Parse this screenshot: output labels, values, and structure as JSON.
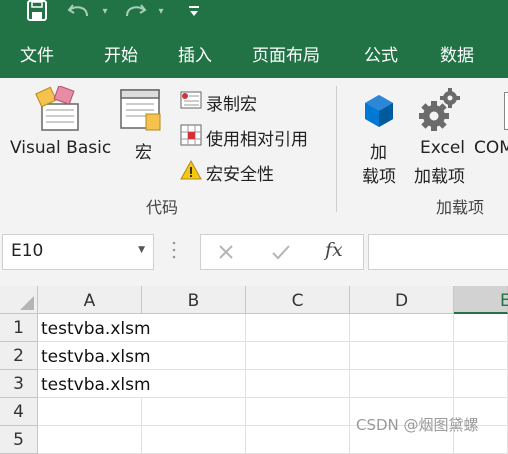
{
  "ribbon_tabs": [
    "文件",
    "开始",
    "插入",
    "页面布局",
    "公式",
    "数据"
  ],
  "code_group": {
    "visual_basic_label": "Visual Basic",
    "macros_label": "宏",
    "record_macro_label": "录制宏",
    "relative_refs_label": "使用相对引用",
    "macro_security_label": "宏安全性",
    "group_label": "代码"
  },
  "addins_group": {
    "addins_label_line1": "加",
    "addins_label_line2": "载项",
    "excel_addins_line1": "Excel",
    "excel_addins_line2": "加载项",
    "com_label": "COM",
    "group_label": "加载项"
  },
  "formula_bar": {
    "name_box": "E10",
    "fx_label": "fx",
    "formula_value": ""
  },
  "columns": [
    "A",
    "B",
    "C",
    "D",
    "E"
  ],
  "rows": [
    {
      "num": "1",
      "a": "testvba.xlsm"
    },
    {
      "num": "2",
      "a": "testvba.xlsm"
    },
    {
      "num": "3",
      "a": "testvba.xlsm"
    },
    {
      "num": "4",
      "a": ""
    },
    {
      "num": "5",
      "a": ""
    }
  ],
  "watermark": "CSDN @烟图黛螺",
  "colors": {
    "excel_green": "#217346",
    "office_blue": "#0078d4",
    "warning_yellow": "#f2c811"
  },
  "icons": [
    "save-icon",
    "undo-icon",
    "redo-icon",
    "customize-qat-icon",
    "visual-basic-icon",
    "macros-icon",
    "record-macro-icon",
    "relative-references-icon",
    "warning-icon",
    "store-addins-icon",
    "excel-addins-gear-icon",
    "name-box-dropdown-icon",
    "cancel-x-icon",
    "enter-check-icon",
    "insert-function-icon"
  ]
}
